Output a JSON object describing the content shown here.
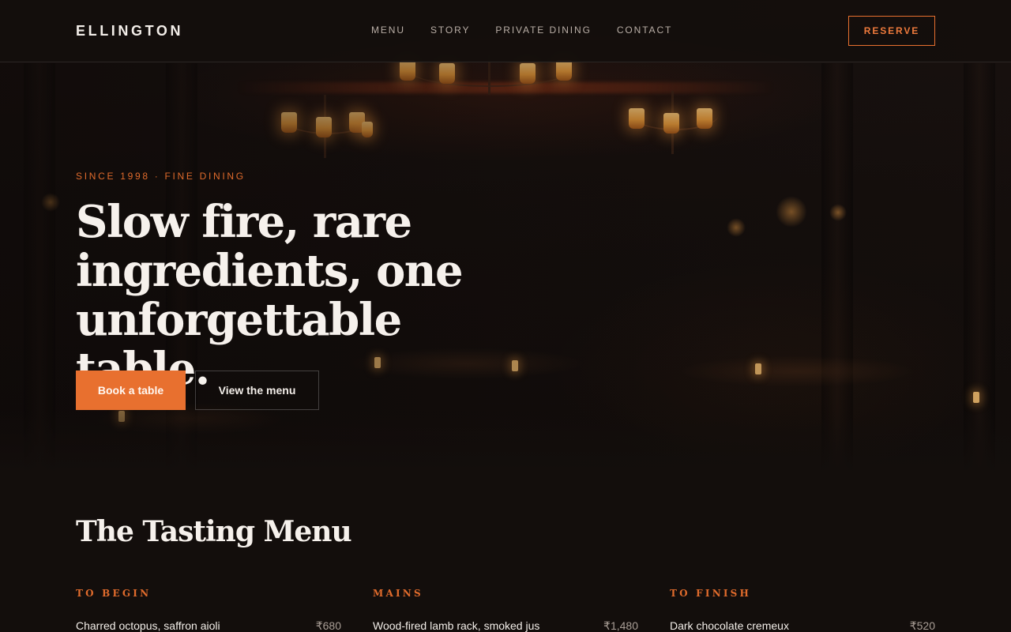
{
  "nav": {
    "brand": "ELLINGTON",
    "links": [
      "MENU",
      "STORY",
      "PRIVATE DINING",
      "CONTACT"
    ],
    "reserve_label": "RESERVE"
  },
  "hero": {
    "eyebrow": "SINCE 1998 · FINE DINING",
    "headline": "Slow fire, rare ingredients, one unforgettable table.",
    "primary_cta": "Book a table",
    "secondary_cta": "View the menu"
  },
  "menu": {
    "title": "The Tasting Menu",
    "columns": [
      {
        "label": "TO BEGIN",
        "items": [
          {
            "name": "Charred octopus, saffron aioli",
            "price": "₹680"
          }
        ]
      },
      {
        "label": "MAINS",
        "items": [
          {
            "name": "Wood-fired lamb rack, smoked jus",
            "price": "₹1,480"
          }
        ]
      },
      {
        "label": "TO FINISH",
        "items": [
          {
            "name": "Dark chocolate cremeux",
            "price": "₹520"
          }
        ]
      }
    ]
  },
  "colors": {
    "accent": "#e8702f",
    "background": "#130e0c",
    "text": "#f3eee9"
  }
}
